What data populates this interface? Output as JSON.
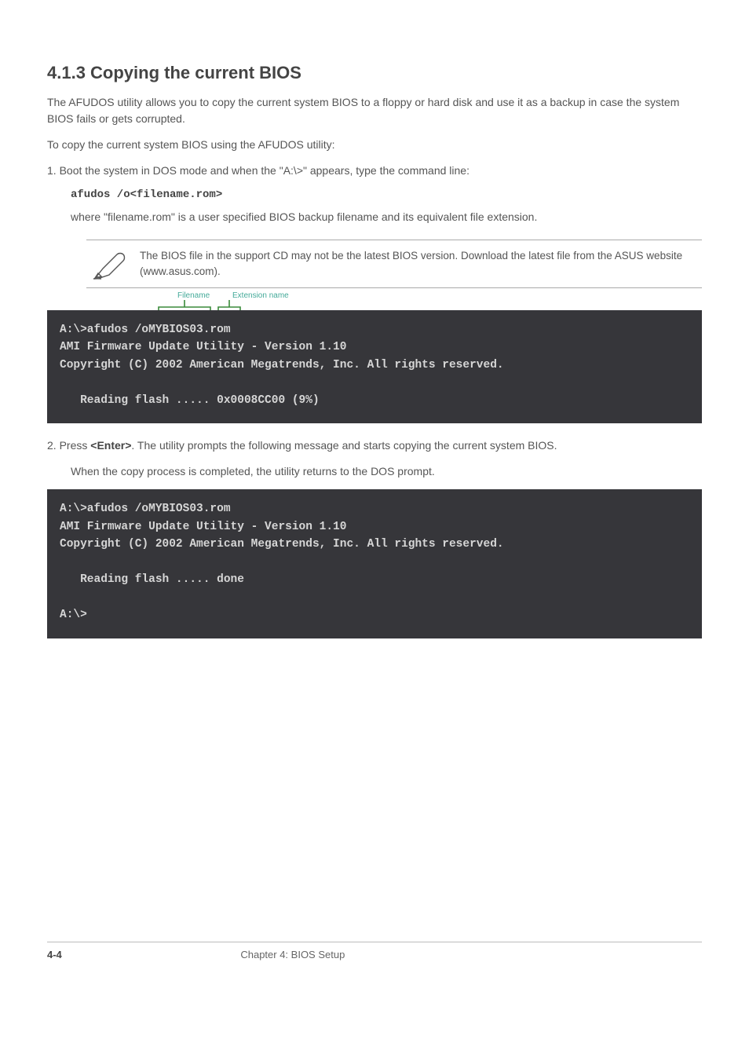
{
  "section": {
    "heading": "4.1.3 Copying the current BIOS",
    "intro": "The AFUDOS utility allows you to copy the current system BIOS to a floppy or hard disk and use it as a backup in case the system BIOS fails or gets corrupted.",
    "step_intro": "To copy the current system BIOS using the AFUDOS utility:",
    "step1": "Boot the system in DOS mode and when the \"A:\\>\" appears, type the command line:",
    "cmd": "afudos /o<filename.rom>",
    "where": "where \"filename.rom\" is a user specified BIOS backup filename and its equivalent file extension.",
    "step2": "Press"
  },
  "note": {
    "text": "The BIOS file in the support CD may not be the latest BIOS version. Download the latest file from the ASUS website (www.asus.com)."
  },
  "bracket_labels": {
    "filename": "Filename",
    "extension": "Extension name"
  },
  "terminal1": {
    "line1": "A:\\>afudos /oMYBIOS03.rom",
    "line2": "AMI Firmware Update Utility - Version 1.10",
    "line3": "Copyright (C) 2002 American Megatrends, Inc. All rights reserved.",
    "line4": "   Reading flash ..... 0x0008CC00 (9%)"
  },
  "enter_text": "<Enter>",
  "after_enter": ". The utility prompts the following message and starts copying the current system BIOS.",
  "term2_intro": "When the copy process is completed, the utility returns to the DOS prompt.",
  "terminal2": {
    "line1": "A:\\>afudos /oMYBIOS03.rom",
    "line2": "AMI Firmware Update Utility - Version 1.10",
    "line3": "Copyright (C) 2002 American Megatrends, Inc. All rights reserved.",
    "line4": "   Reading flash ..... done",
    "line5": "A:\\>"
  },
  "footer": {
    "page": "4-4",
    "chapter": "Chapter 4: BIOS Setup"
  }
}
